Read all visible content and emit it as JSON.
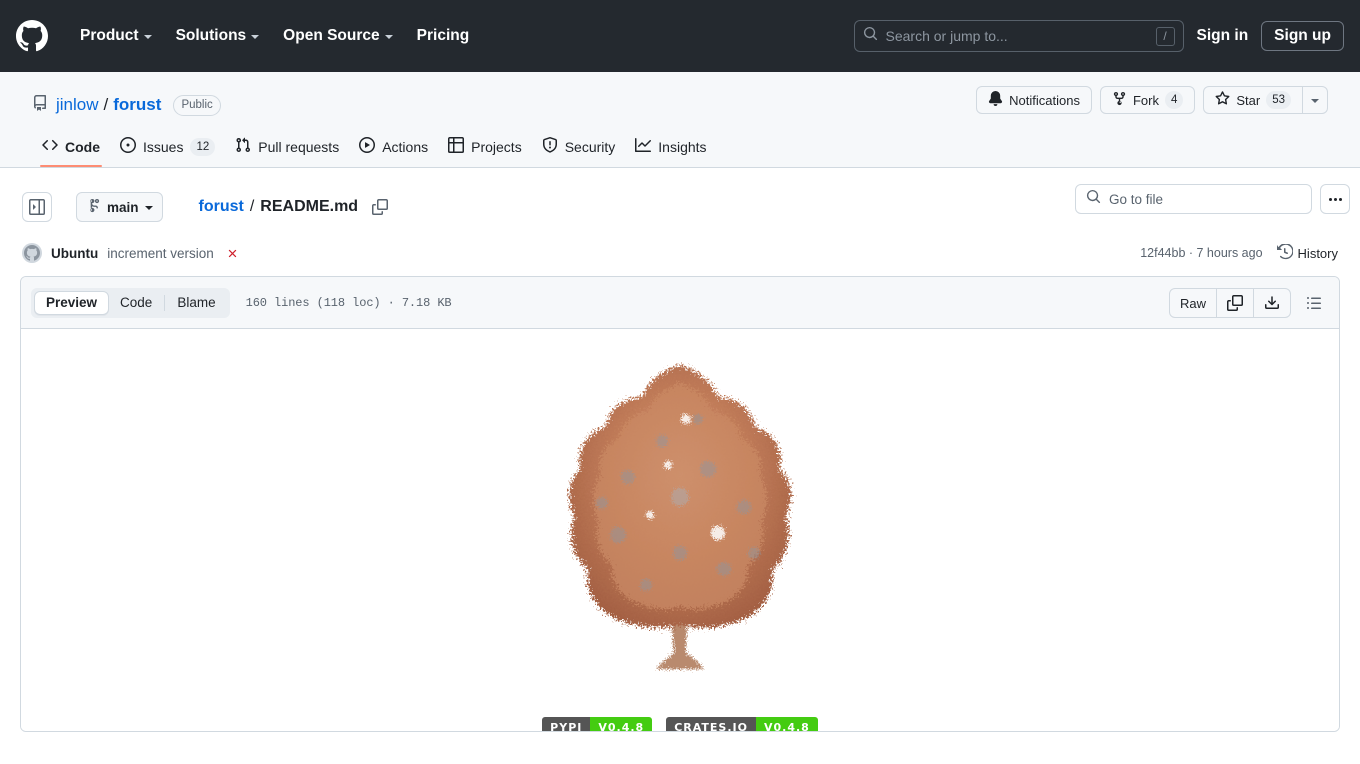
{
  "global_header": {
    "logo_icon": "github-mark-icon",
    "nav": [
      {
        "label": "Product",
        "has_caret": true
      },
      {
        "label": "Solutions",
        "has_caret": true
      },
      {
        "label": "Open Source",
        "has_caret": true
      },
      {
        "label": "Pricing",
        "has_caret": false
      }
    ],
    "search": {
      "placeholder": "Search or jump to...",
      "shortcut": "/",
      "icon": "search-icon"
    },
    "sign_in": "Sign in",
    "sign_up": "Sign up"
  },
  "repo": {
    "icon": "repo-icon",
    "owner": "jinlow",
    "separator": "/",
    "name": "forust",
    "visibility": "Public",
    "actions": {
      "notifications": {
        "label": "Notifications",
        "icon": "bell-icon"
      },
      "fork": {
        "label": "Fork",
        "count": "4",
        "icon": "fork-icon"
      },
      "star": {
        "label": "Star",
        "count": "53",
        "icon": "star-icon"
      }
    },
    "tabs": [
      {
        "label": "Code",
        "icon": "code-icon",
        "active": true
      },
      {
        "label": "Issues",
        "icon": "issue-opened-icon",
        "count": "12"
      },
      {
        "label": "Pull requests",
        "icon": "git-pull-request-icon"
      },
      {
        "label": "Actions",
        "icon": "play-icon"
      },
      {
        "label": "Projects",
        "icon": "table-icon"
      },
      {
        "label": "Security",
        "icon": "shield-icon"
      },
      {
        "label": "Insights",
        "icon": "graph-icon"
      }
    ]
  },
  "file_nav": {
    "sidebar_toggle_icon": "sidebar-expand-icon",
    "branch": {
      "label": "main",
      "icon": "git-branch-icon"
    },
    "breadcrumb": {
      "root": "forust",
      "separator": "/",
      "current": "README.md"
    },
    "copy_path_icon": "copy-icon",
    "go_to_file": {
      "placeholder": "Go to file",
      "icon": "search-icon"
    },
    "more_icon": "kebab-horizontal-icon"
  },
  "commit": {
    "avatar_icon": "avatar-icon",
    "author": "Ubuntu",
    "message": "increment version",
    "status_icon": "x-failed-icon",
    "sha_and_time": "12f44bb · 7 hours ago",
    "history_label": "History",
    "history_icon": "history-icon"
  },
  "file_view": {
    "tabs": [
      {
        "label": "Preview",
        "active": true
      },
      {
        "label": "Code",
        "active": false
      },
      {
        "label": "Blame",
        "active": false
      }
    ],
    "meta": "160 lines (118 loc) · 7.18 KB",
    "raw_label": "Raw",
    "copy_icon": "copy-icon",
    "download_icon": "download-icon",
    "outline_icon": "list-unordered-icon"
  },
  "readme": {
    "logo_alt": "forust-tree-logo",
    "badges": [
      {
        "label": "PYPI",
        "value": "V0.4.8",
        "label_color": "#555555",
        "value_color": "#44cc11"
      },
      {
        "label": "CRATES.IO",
        "value": "V0.4.8",
        "label_color": "#555555",
        "value_color": "#44cc11"
      }
    ]
  },
  "colors": {
    "header_bg": "#24292f",
    "accent_link": "#0969da",
    "tab_underline": "#fd8c73",
    "border": "#d1d9e0",
    "muted_text": "#59636e",
    "danger": "#cf222e"
  }
}
